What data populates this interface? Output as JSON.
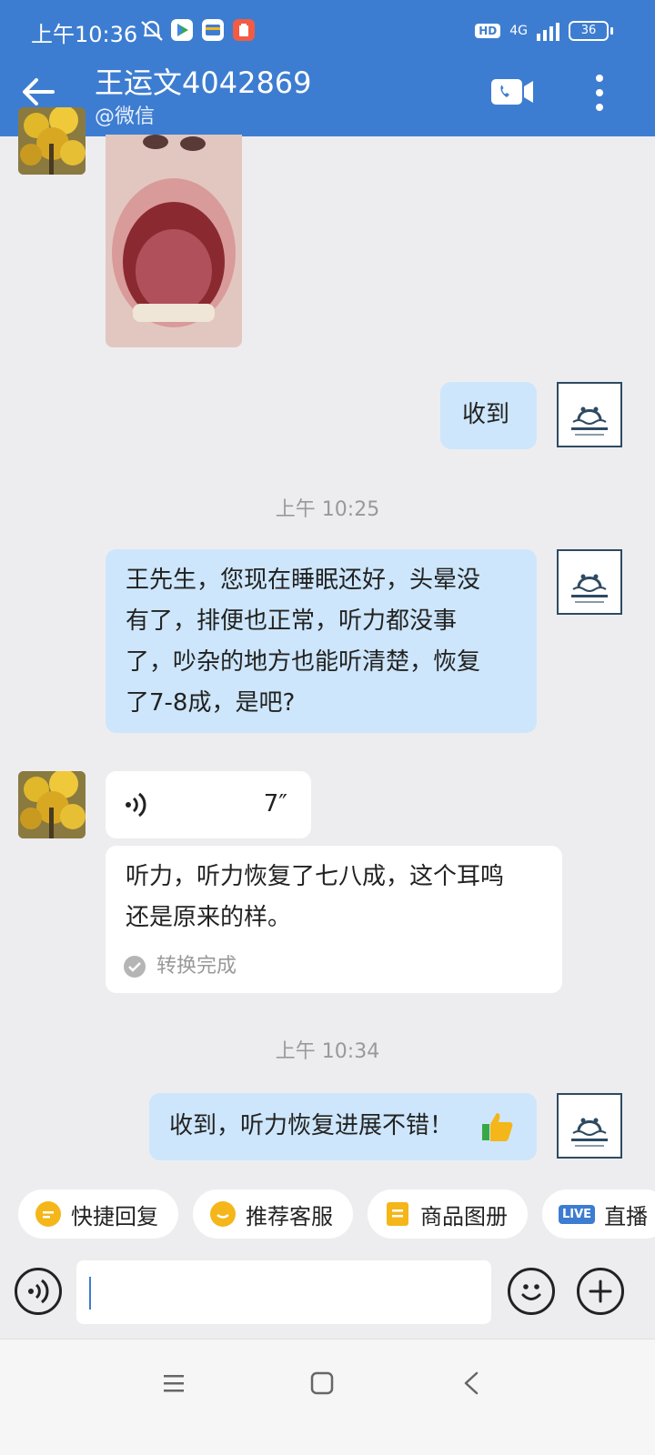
{
  "status_bar": {
    "time": "上午10:36",
    "network": "4G",
    "hd_badge": "HD",
    "battery": "36",
    "icons": [
      "mute-icon",
      "play-store-icon",
      "wallet-icon",
      "clipboard-icon"
    ]
  },
  "header": {
    "title": "王运文4042869",
    "subtitle": "@微信",
    "icons": [
      "back-arrow-icon",
      "video-call-icon",
      "more-icon"
    ]
  },
  "messages": [
    {
      "from": "other",
      "type": "image",
      "description_icon": "photo-icon"
    },
    {
      "from": "me",
      "type": "text",
      "text": "收到"
    },
    {
      "type": "timestamp",
      "text": "上午 10:25"
    },
    {
      "from": "me",
      "type": "text",
      "lines": [
        "王先生，您现在睡眠还好，头晕没",
        "有了，排便也正常，听力都没事",
        "了，吵杂的地方也能听清楚，恢复",
        "了7-8成，是吧?"
      ]
    },
    {
      "from": "other",
      "type": "voice",
      "duration": "7″"
    },
    {
      "from": "other",
      "type": "transcript",
      "lines": [
        "听力，听力恢复了七八成，这个耳鸣",
        "还是原来的样。"
      ],
      "status": "转换完成"
    },
    {
      "type": "timestamp",
      "text": "上午 10:34"
    },
    {
      "from": "me",
      "type": "text",
      "text": "收到，听力恢复进展不错！"
    }
  ],
  "quick_replies": [
    {
      "label": "快捷回复",
      "icon": "quick-reply-icon",
      "color": "#f4b619"
    },
    {
      "label": "推荐客服",
      "icon": "agent-icon",
      "color": "#f4b619"
    },
    {
      "label": "商品图册",
      "icon": "catalog-icon",
      "color": "#f4b619"
    },
    {
      "label": "直播",
      "icon": "live-icon",
      "badge": "LIVE",
      "color": "#3d7dd1"
    }
  ],
  "input": {
    "value": "",
    "placeholder": ""
  },
  "colors": {
    "header": "#3d7dd1",
    "my_bubble": "#cde6fb",
    "background": "#ededf0"
  }
}
